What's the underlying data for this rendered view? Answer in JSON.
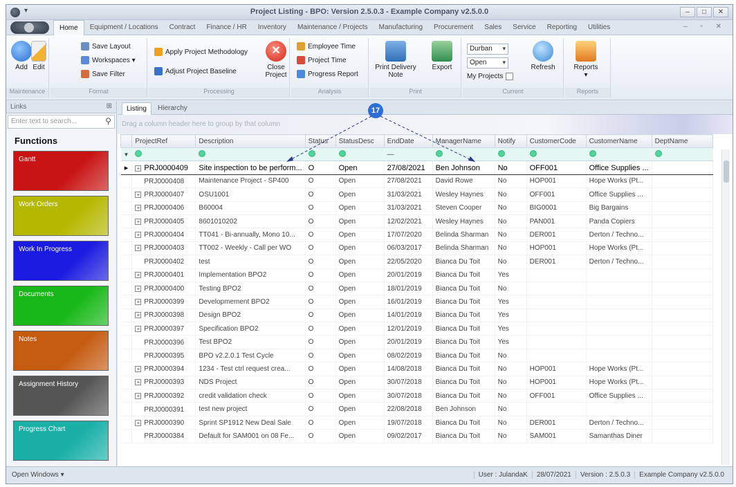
{
  "window": {
    "title": "Project Listing - BPO: Version 2.5.0.3 - Example Company v2.5.0.0",
    "quick_access": "▾",
    "buttons": [
      "–",
      "□",
      "✕"
    ]
  },
  "ribbon_tabs": [
    "Home",
    "Equipment / Locations",
    "Contract",
    "Finance / HR",
    "Inventory",
    "Maintenance / Projects",
    "Manufacturing",
    "Procurement",
    "Sales",
    "Service",
    "Reporting",
    "Utilities"
  ],
  "ribbon": {
    "maintenance": {
      "add": "Add",
      "edit": "Edit",
      "label": "Maintenance"
    },
    "format": {
      "save_layout": "Save Layout",
      "workspaces": "Workspaces ▾",
      "save_filter": "Save Filter",
      "label": "Format"
    },
    "processing": {
      "apply_methodology": "Apply Project Methodology",
      "adjust_baseline": "Adjust Project Baseline",
      "close_project": "Close Project",
      "label": "Processing"
    },
    "analysis": {
      "employee_time": "Employee Time",
      "project_time": "Project Time",
      "progress_report": "Progress Report",
      "label": "Analysis"
    },
    "print": {
      "print_delivery_note": "Print Delivery Note",
      "export": "Export",
      "label": "Print"
    },
    "current": {
      "site": "Durban",
      "status": "Open",
      "my_projects": "My Projects",
      "refresh": "Refresh",
      "label": "Current"
    },
    "reports": {
      "reports": "Reports",
      "label": "Reports"
    }
  },
  "links": {
    "header": "Links",
    "search_placeholder": "Enter text to search...",
    "functions_title": "Functions",
    "tiles": [
      {
        "label": "Gantt",
        "color": "#c81414"
      },
      {
        "label": "Work Orders",
        "color": "#b5b800"
      },
      {
        "label": "Work In Progress",
        "color": "#1a1ae0"
      },
      {
        "label": "Documents",
        "color": "#17b817"
      },
      {
        "label": "Notes",
        "color": "#c55a11"
      },
      {
        "label": "Assignment History",
        "color": "#555555"
      },
      {
        "label": "Progress Chart",
        "color": "#1ab0a8"
      }
    ]
  },
  "content_tabs": [
    "Listing",
    "Hierarchy"
  ],
  "group_hint": "Drag a column header here to group by that column",
  "callout_number": "17",
  "columns": [
    "ProjectRef",
    "Description",
    "Status",
    "StatusDesc",
    "EndDate",
    "ManagerName",
    "Notify",
    "CustomerCode",
    "CustomerName",
    "DeptName"
  ],
  "filter_placeholder_enddate": "—",
  "rows": [
    {
      "exp": "+",
      "ref": "PRJ0000409",
      "desc": "Site inspection to be perform...",
      "status": "O",
      "sdesc": "Open",
      "end": "27/08/2021",
      "mgr": "Ben Johnson",
      "notify": "No",
      "ccode": "OFF001",
      "cname": "Office Supplies ...",
      "dept": ""
    },
    {
      "exp": "",
      "ref": "PRJ0000408",
      "desc": "Maintenance Project - SP400",
      "status": "O",
      "sdesc": "Open",
      "end": "27/08/2021",
      "mgr": "David Rowe",
      "notify": "No",
      "ccode": "HOP001",
      "cname": "Hope Works (Pt...",
      "dept": ""
    },
    {
      "exp": "+",
      "ref": "PRJ0000407",
      "desc": "OSU1001",
      "status": "O",
      "sdesc": "Open",
      "end": "31/03/2021",
      "mgr": "Wesley Haynes",
      "notify": "No",
      "ccode": "OFF001",
      "cname": "Office Supplies ...",
      "dept": ""
    },
    {
      "exp": "+",
      "ref": "PRJ0000406",
      "desc": "B60004",
      "status": "O",
      "sdesc": "Open",
      "end": "31/03/2021",
      "mgr": "Steven Cooper",
      "notify": "No",
      "ccode": "BIG0001",
      "cname": "Big Bargains",
      "dept": ""
    },
    {
      "exp": "+",
      "ref": "PRJ0000405",
      "desc": "8601010202",
      "status": "O",
      "sdesc": "Open",
      "end": "12/02/2021",
      "mgr": "Wesley Haynes",
      "notify": "No",
      "ccode": "PAN001",
      "cname": "Panda Copiers",
      "dept": ""
    },
    {
      "exp": "+",
      "ref": "PRJ0000404",
      "desc": "TT041 - Bi-annually, Mono 10...",
      "status": "O",
      "sdesc": "Open",
      "end": "17/07/2020",
      "mgr": "Belinda Sharman",
      "notify": "No",
      "ccode": "DER001",
      "cname": "Derton / Techno...",
      "dept": ""
    },
    {
      "exp": "+",
      "ref": "PRJ0000403",
      "desc": "TT002 - Weekly - Call per WO",
      "status": "O",
      "sdesc": "Open",
      "end": "06/03/2017",
      "mgr": "Belinda Sharman",
      "notify": "No",
      "ccode": "HOP001",
      "cname": "Hope Works (Pt...",
      "dept": ""
    },
    {
      "exp": "",
      "ref": "PRJ0000402",
      "desc": "test",
      "status": "O",
      "sdesc": "Open",
      "end": "22/05/2020",
      "mgr": "Bianca Du Toit",
      "notify": "No",
      "ccode": "DER001",
      "cname": "Derton / Techno...",
      "dept": ""
    },
    {
      "exp": "+",
      "ref": "PRJ0000401",
      "desc": "Implementation BPO2",
      "status": "O",
      "sdesc": "Open",
      "end": "20/01/2019",
      "mgr": "Bianca Du Toit",
      "notify": "Yes",
      "ccode": "",
      "cname": "",
      "dept": ""
    },
    {
      "exp": "+",
      "ref": "PRJ0000400",
      "desc": "Testing BPO2",
      "status": "O",
      "sdesc": "Open",
      "end": "18/01/2019",
      "mgr": "Bianca Du Toit",
      "notify": "No",
      "ccode": "",
      "cname": "",
      "dept": ""
    },
    {
      "exp": "+",
      "ref": "PRJ0000399",
      "desc": "Developmement BPO2",
      "status": "O",
      "sdesc": "Open",
      "end": "16/01/2019",
      "mgr": "Bianca Du Toit",
      "notify": "Yes",
      "ccode": "",
      "cname": "",
      "dept": ""
    },
    {
      "exp": "+",
      "ref": "PRJ0000398",
      "desc": "Design BPO2",
      "status": "O",
      "sdesc": "Open",
      "end": "14/01/2019",
      "mgr": "Bianca Du Toit",
      "notify": "Yes",
      "ccode": "",
      "cname": "",
      "dept": ""
    },
    {
      "exp": "+",
      "ref": "PRJ0000397",
      "desc": "Specification BPO2",
      "status": "O",
      "sdesc": "Open",
      "end": "12/01/2019",
      "mgr": "Bianca Du Toit",
      "notify": "Yes",
      "ccode": "",
      "cname": "",
      "dept": ""
    },
    {
      "exp": "",
      "ref": "PRJ0000396",
      "desc": "Test BPO2",
      "status": "O",
      "sdesc": "Open",
      "end": "20/01/2019",
      "mgr": "Bianca Du Toit",
      "notify": "Yes",
      "ccode": "",
      "cname": "",
      "dept": ""
    },
    {
      "exp": "",
      "ref": "PRJ0000395",
      "desc": "BPO v2.2.0.1 Test Cycle",
      "status": "O",
      "sdesc": "Open",
      "end": "08/02/2019",
      "mgr": "Bianca Du Toit",
      "notify": "No",
      "ccode": "",
      "cname": "",
      "dept": ""
    },
    {
      "exp": "+",
      "ref": "PRJ0000394",
      "desc": "1234 - Test ctrl request crea...",
      "status": "O",
      "sdesc": "Open",
      "end": "14/08/2018",
      "mgr": "Bianca Du Toit",
      "notify": "No",
      "ccode": "HOP001",
      "cname": "Hope Works (Pt...",
      "dept": ""
    },
    {
      "exp": "+",
      "ref": "PRJ0000393",
      "desc": "NDS Project",
      "status": "O",
      "sdesc": "Open",
      "end": "30/07/2018",
      "mgr": "Bianca Du Toit",
      "notify": "No",
      "ccode": "HOP001",
      "cname": "Hope Works (Pt...",
      "dept": ""
    },
    {
      "exp": "+",
      "ref": "PRJ0000392",
      "desc": "credit validation check",
      "status": "O",
      "sdesc": "Open",
      "end": "30/07/2018",
      "mgr": "Bianca Du Toit",
      "notify": "No",
      "ccode": "OFF001",
      "cname": "Office Supplies ...",
      "dept": ""
    },
    {
      "exp": "",
      "ref": "PRJ0000391",
      "desc": "test new project",
      "status": "O",
      "sdesc": "Open",
      "end": "22/08/2018",
      "mgr": "Ben Johnson",
      "notify": "No",
      "ccode": "",
      "cname": "",
      "dept": ""
    },
    {
      "exp": "+",
      "ref": "PRJ0000390",
      "desc": "Sprint SP1912 New Deal Sale",
      "status": "O",
      "sdesc": "Open",
      "end": "19/07/2018",
      "mgr": "Bianca Du Toit",
      "notify": "No",
      "ccode": "DER001",
      "cname": "Derton / Techno...",
      "dept": ""
    },
    {
      "exp": "",
      "ref": "PRJ0000384",
      "desc": "Default for SAM001 on 08 Fe...",
      "status": "O",
      "sdesc": "Open",
      "end": "09/02/2017",
      "mgr": "Bianca Du Toit",
      "notify": "No",
      "ccode": "SAM001",
      "cname": "Samanthas Diner",
      "dept": ""
    }
  ],
  "statusbar": {
    "open_windows": "Open Windows ▾",
    "user": "User : JulandaK",
    "date": "28/07/2021",
    "version": "Version : 2.5.0.3",
    "company": "Example Company v2.5.0.0"
  }
}
